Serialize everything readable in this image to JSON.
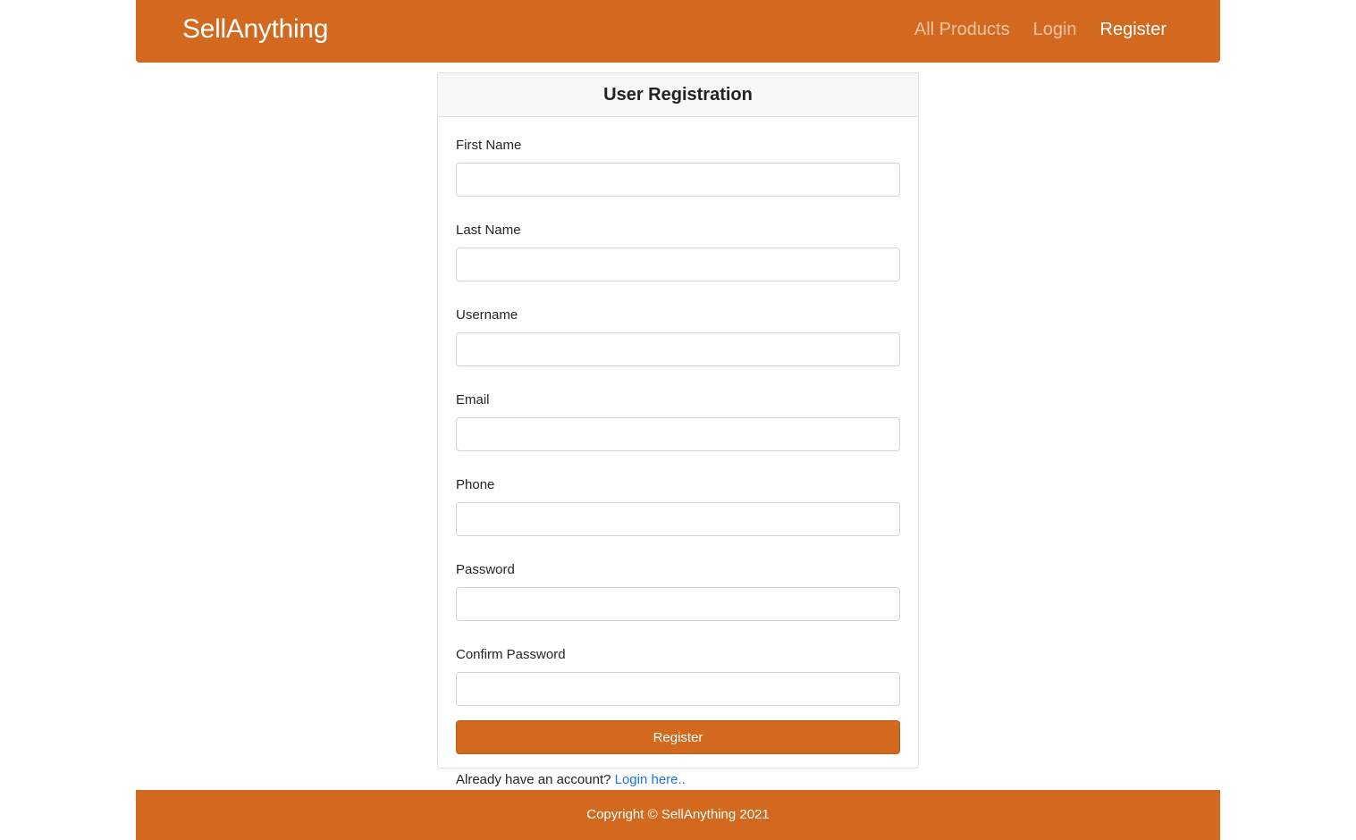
{
  "navbar": {
    "brand": "SellAnything",
    "links": [
      {
        "label": "All Products"
      },
      {
        "label": "Login"
      },
      {
        "label": "Register"
      }
    ]
  },
  "registration": {
    "title": "User Registration",
    "fields": [
      {
        "label": "First Name",
        "value": ""
      },
      {
        "label": "Last Name",
        "value": ""
      },
      {
        "label": "Username",
        "value": ""
      },
      {
        "label": "Email",
        "value": ""
      },
      {
        "label": "Phone",
        "value": ""
      },
      {
        "label": "Password",
        "value": ""
      },
      {
        "label": "Confirm Password",
        "value": ""
      }
    ],
    "submit_label": "Register",
    "login_prompt": "Already have an account?",
    "login_link": "Login here.."
  },
  "footer": {
    "copyright": "Copyright © SellAnything 2021"
  },
  "colors": {
    "accent": "#d2691e",
    "link": "#1a73e8"
  }
}
